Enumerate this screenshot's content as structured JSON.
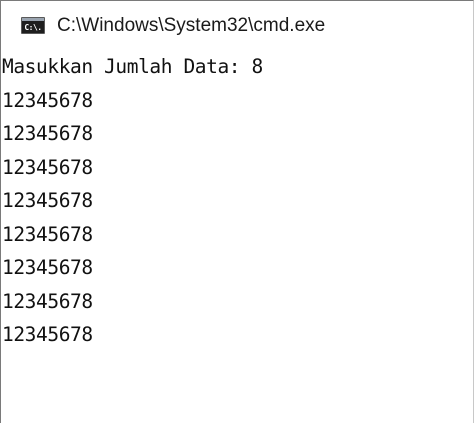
{
  "window": {
    "title": "C:\\Windows\\System32\\cmd.exe",
    "icon_name": "cmd-icon",
    "icon_text": "C:\\."
  },
  "console": {
    "prompt_line": "Masukkan Jumlah Data: 8",
    "output_lines": [
      "12345678",
      "12345678",
      "12345678",
      "12345678",
      "12345678",
      "12345678",
      "12345678",
      "12345678"
    ]
  }
}
